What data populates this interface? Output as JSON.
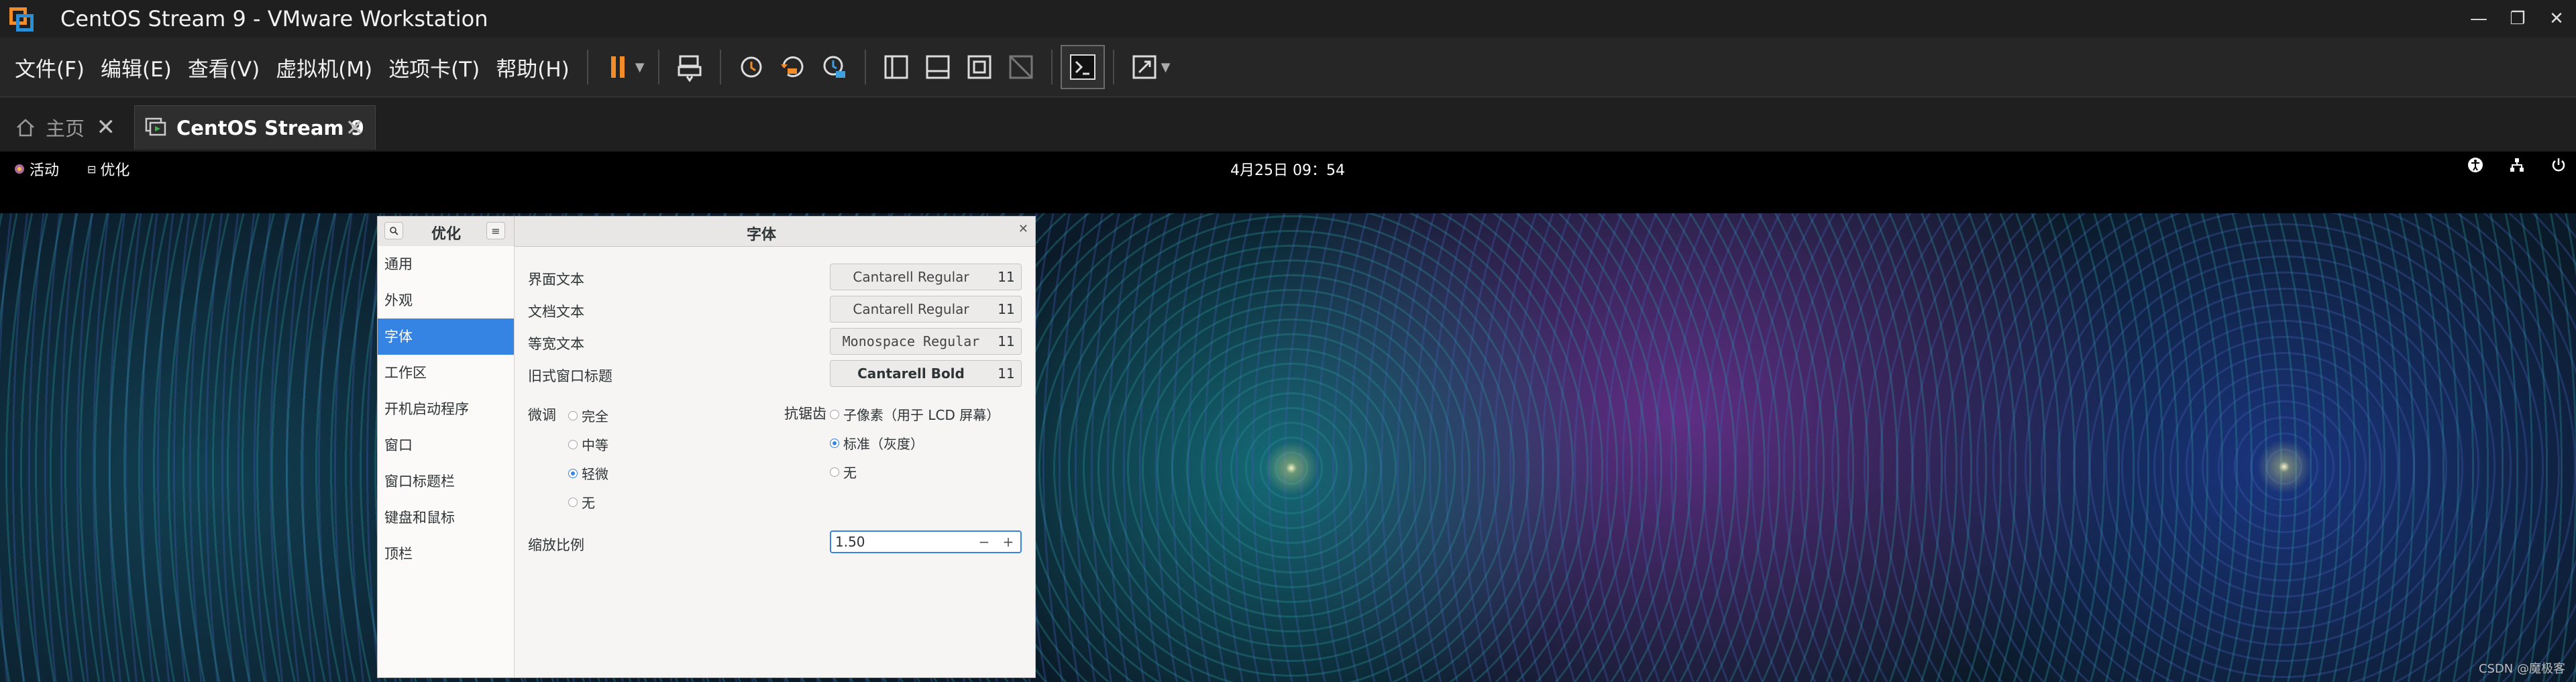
{
  "window": {
    "title": "CentOS Stream 9 - VMware Workstation",
    "controls": [
      "—",
      "❐",
      "✕"
    ]
  },
  "menu": {
    "items": [
      "文件(F)",
      "编辑(E)",
      "查看(V)",
      "虚拟机(M)",
      "选项卡(T)",
      "帮助(H)"
    ]
  },
  "toolbar": {
    "icons": [
      "pause-icon",
      "send-ctrl-alt-del-icon",
      "snapshot-icon",
      "revert-snapshot-icon",
      "snapshot-manager-icon",
      "show-library-icon",
      "thumbnail-bar-icon",
      "full-screen-icon",
      "unity-icon",
      "console-view-icon",
      "stretch-icon"
    ],
    "pause_color": "#f28c28"
  },
  "tabs": [
    {
      "label": "主页",
      "active": false
    },
    {
      "label": "CentOS Stream 9",
      "active": true
    }
  ],
  "gnome": {
    "activities": "活动",
    "app_name": "优化",
    "clock": "4月25日  09：54"
  },
  "tweaks": {
    "sidebar_title": "优化",
    "panel_title": "字体",
    "sidebar_items": [
      "通用",
      "外观",
      "字体",
      "工作区",
      "开机启动程序",
      "窗口",
      "窗口标题栏",
      "键盘和鼠标",
      "顶栏"
    ],
    "selected_item": "字体",
    "fonts": [
      {
        "label": "界面文本",
        "font": "Cantarell Regular",
        "size": "11"
      },
      {
        "label": "文档文本",
        "font": "Cantarell Regular",
        "size": "11"
      },
      {
        "label": "等宽文本",
        "font": "Monospace Regular",
        "size": "11"
      },
      {
        "label": "旧式窗口标题",
        "font": "Cantarell Bold",
        "size": "11"
      }
    ],
    "hinting": {
      "label": "微调",
      "options": [
        "完全",
        "中等",
        "轻微",
        "无"
      ],
      "selected": "轻微"
    },
    "antialiasing": {
      "label": "抗锯齿",
      "options": [
        "子像素（用于 LCD 屏幕）",
        "标准（灰度）",
        "无"
      ],
      "selected": "标准（灰度）"
    },
    "scaling": {
      "label": "缩放比例",
      "value": "1.50",
      "minus": "−",
      "plus": "+"
    },
    "accent_color": "#3584e4"
  },
  "watermark": "CSDN @魔极客"
}
